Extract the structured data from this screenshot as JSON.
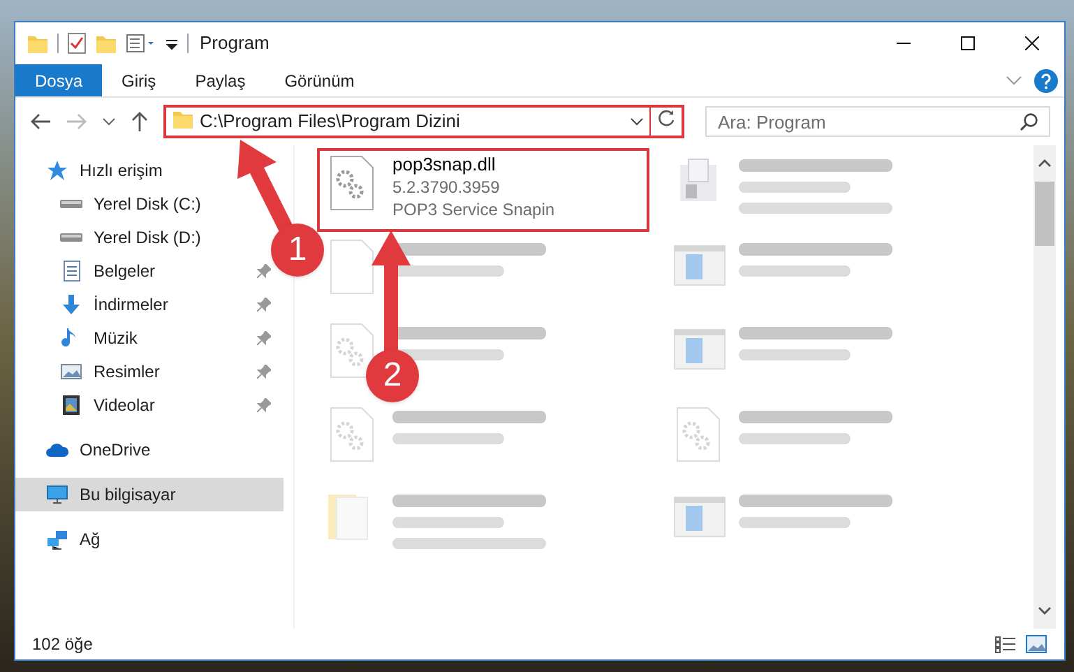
{
  "window": {
    "title": "Program"
  },
  "ribbon_tabs": [
    {
      "label": "Dosya",
      "selected": true
    },
    {
      "label": "Giriş",
      "selected": false
    },
    {
      "label": "Paylaş",
      "selected": false
    },
    {
      "label": "Görünüm",
      "selected": false
    }
  ],
  "address_bar": {
    "path": "C:\\Program Files\\Program Dizini",
    "highlighted": true
  },
  "search": {
    "placeholder": "Ara: Program"
  },
  "sidebar": {
    "items": [
      {
        "label": "Hızlı erişim",
        "kind": "quick",
        "pinned": false,
        "selected": false
      },
      {
        "label": "Yerel Disk (C:)",
        "kind": "drive",
        "pinned": false,
        "selected": false
      },
      {
        "label": "Yerel Disk (D:)",
        "kind": "drive",
        "pinned": false,
        "selected": false
      },
      {
        "label": "Belgeler",
        "kind": "docs",
        "pinned": true,
        "selected": false
      },
      {
        "label": "İndirmeler",
        "kind": "download",
        "pinned": true,
        "selected": false
      },
      {
        "label": "Müzik",
        "kind": "music",
        "pinned": true,
        "selected": false
      },
      {
        "label": "Resimler",
        "kind": "pictures",
        "pinned": true,
        "selected": false
      },
      {
        "label": "Videolar",
        "kind": "videos",
        "pinned": true,
        "selected": false
      },
      {
        "label": "OneDrive",
        "kind": "cloud",
        "pinned": false,
        "selected": false
      },
      {
        "label": "Bu bilgisayar",
        "kind": "pc",
        "pinned": false,
        "selected": true
      },
      {
        "label": "Ağ",
        "kind": "network",
        "pinned": false,
        "selected": false
      }
    ]
  },
  "files": [
    {
      "name": "pop3snap.dll",
      "lines": [
        "5.2.3790.3959",
        "POP3 Service Snapin"
      ],
      "kind": "dll",
      "highlighted": true,
      "blurred": false
    },
    {
      "kind": "exe",
      "highlighted": false,
      "blurred": true,
      "tall": true
    },
    {
      "kind": "file",
      "highlighted": false,
      "blurred": true,
      "tall": false
    },
    {
      "kind": "installer",
      "highlighted": false,
      "blurred": true,
      "tall": false
    },
    {
      "kind": "dll",
      "highlighted": false,
      "blurred": true,
      "tall": false
    },
    {
      "kind": "installer",
      "highlighted": false,
      "blurred": true,
      "tall": false
    },
    {
      "kind": "dll",
      "highlighted": false,
      "blurred": true,
      "tall": false
    },
    {
      "kind": "dll",
      "highlighted": false,
      "blurred": true,
      "tall": false
    },
    {
      "kind": "folder",
      "highlighted": false,
      "blurred": true,
      "tall": true
    },
    {
      "kind": "installer",
      "highlighted": false,
      "blurred": true,
      "tall": false
    }
  ],
  "status_bar": {
    "count": "102 öğe"
  },
  "annotations": [
    {
      "label": "1"
    },
    {
      "label": "2"
    }
  ]
}
